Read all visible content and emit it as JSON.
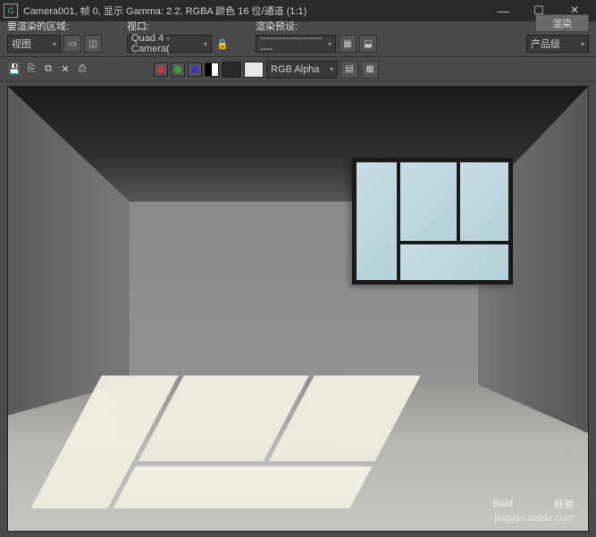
{
  "titlebar": {
    "icon_letter": "G",
    "title": "Camera001, 帧 0, 显示 Gamma: 2.2, RGBA 颜色 16 位/通道 (1:1)"
  },
  "toolbar": {
    "area_label": "要渲染的区域:",
    "area_value": "视图",
    "viewport_label": "视口:",
    "viewport_value": "Quad 4 - Camera(",
    "preset_label": "渲染预设:",
    "preset_value": "-----------------------",
    "render_btn": "渲染",
    "quality_value": "产品级"
  },
  "toolbar2": {
    "channel_value": "RGB Alpha"
  },
  "watermark": {
    "brand1": "Baid",
    "brand2": "经验",
    "url": "jingyan.baidu.com"
  }
}
